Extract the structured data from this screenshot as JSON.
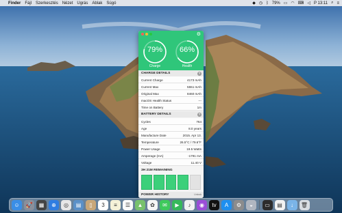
{
  "menubar": {
    "apple": "",
    "items": [
      "Finder",
      "Fájl",
      "Szerkesztés",
      "Nézet",
      "Ugrás",
      "Ablak",
      "Súgó"
    ],
    "battery_percent": "79%",
    "clock": "P 13:11"
  },
  "app": {
    "charge": {
      "value": "79%",
      "label": "Charge",
      "fraction": 0.79
    },
    "health": {
      "value": "66%",
      "label": "Health",
      "fraction": 0.66
    },
    "charge_details": {
      "title": "CHARGE DETAILS",
      "rows": [
        {
          "k": "Current Charge",
          "v": "4173 mAh"
        },
        {
          "k": "Current Max",
          "v": "5551 mAh"
        },
        {
          "k": "Original Max",
          "v": "8460 mAh"
        },
        {
          "k": "macOS Health Status",
          "v": "---"
        },
        {
          "k": "Time on Battery",
          "v": "1m"
        }
      ]
    },
    "battery_details": {
      "title": "BATTERY DETAILS",
      "rows": [
        {
          "k": "Cycles",
          "v": "764"
        },
        {
          "k": "Age",
          "v": "8.0 years"
        },
        {
          "k": "Manufacture Date",
          "v": "2015. Apr 13."
        },
        {
          "k": "Temperature",
          "v": "26.5°C / 79.6°F"
        },
        {
          "k": "Power Usage",
          "v": "19.5 Watts"
        },
        {
          "k": "Amperage (mA)",
          "v": "-1791 mA"
        },
        {
          "k": "Voltage",
          "v": "11.40 V"
        }
      ]
    },
    "remaining": {
      "title": "3H 21M REMAINING",
      "bars_filled": 4,
      "bars_total": 5
    },
    "power_history": {
      "title": "POWER HISTORY",
      "action": "Unlock"
    }
  },
  "dock": {
    "apps": [
      {
        "name": "finder",
        "color": "#3a8ee6",
        "glyph": "☺"
      },
      {
        "name": "launchpad",
        "color": "#8a8f9a",
        "glyph": "🚀"
      },
      {
        "name": "mission-control",
        "color": "#444",
        "glyph": "▦"
      },
      {
        "name": "safari",
        "color": "#2f7de1",
        "glyph": "⊕"
      },
      {
        "name": "chrome",
        "color": "#e7e7e7",
        "glyph": "◎"
      },
      {
        "name": "preview",
        "color": "#5a90c8",
        "glyph": "▤"
      },
      {
        "name": "contacts",
        "color": "#c8a779",
        "glyph": "▯"
      },
      {
        "name": "calendar",
        "color": "#ffffff",
        "glyph": "3"
      },
      {
        "name": "notes",
        "color": "#f5f2d8",
        "glyph": "≡"
      },
      {
        "name": "reminders",
        "color": "#fafafa",
        "glyph": "☰"
      },
      {
        "name": "maps",
        "color": "#78c16d",
        "glyph": "▲"
      },
      {
        "name": "photos",
        "color": "#f6f6f6",
        "glyph": "✿"
      },
      {
        "name": "messages",
        "color": "#3ec95c",
        "glyph": "✉"
      },
      {
        "name": "facetime",
        "color": "#36b85a",
        "glyph": "▶"
      },
      {
        "name": "itunes",
        "color": "#f2f2f2",
        "glyph": "♪"
      },
      {
        "name": "podcasts",
        "color": "#9b4ed8",
        "glyph": "◉"
      },
      {
        "name": "apple-tv",
        "color": "#111",
        "glyph": "tv"
      },
      {
        "name": "app-store",
        "color": "#1e8ff0",
        "glyph": "A"
      },
      {
        "name": "system-preferences",
        "color": "#8c8c8c",
        "glyph": "⚙"
      },
      {
        "name": "disk-utility",
        "color": "#b0b6c0",
        "glyph": "◒"
      },
      {
        "name": "battery-app",
        "color": "#2c2c2c",
        "glyph": "▭"
      },
      {
        "name": "document",
        "color": "#f2f2f2",
        "glyph": "▤"
      },
      {
        "name": "downloads",
        "color": "#7ab4e8",
        "glyph": "↓"
      },
      {
        "name": "trash",
        "color": "#d8dde2",
        "glyph": "🗑"
      }
    ]
  }
}
